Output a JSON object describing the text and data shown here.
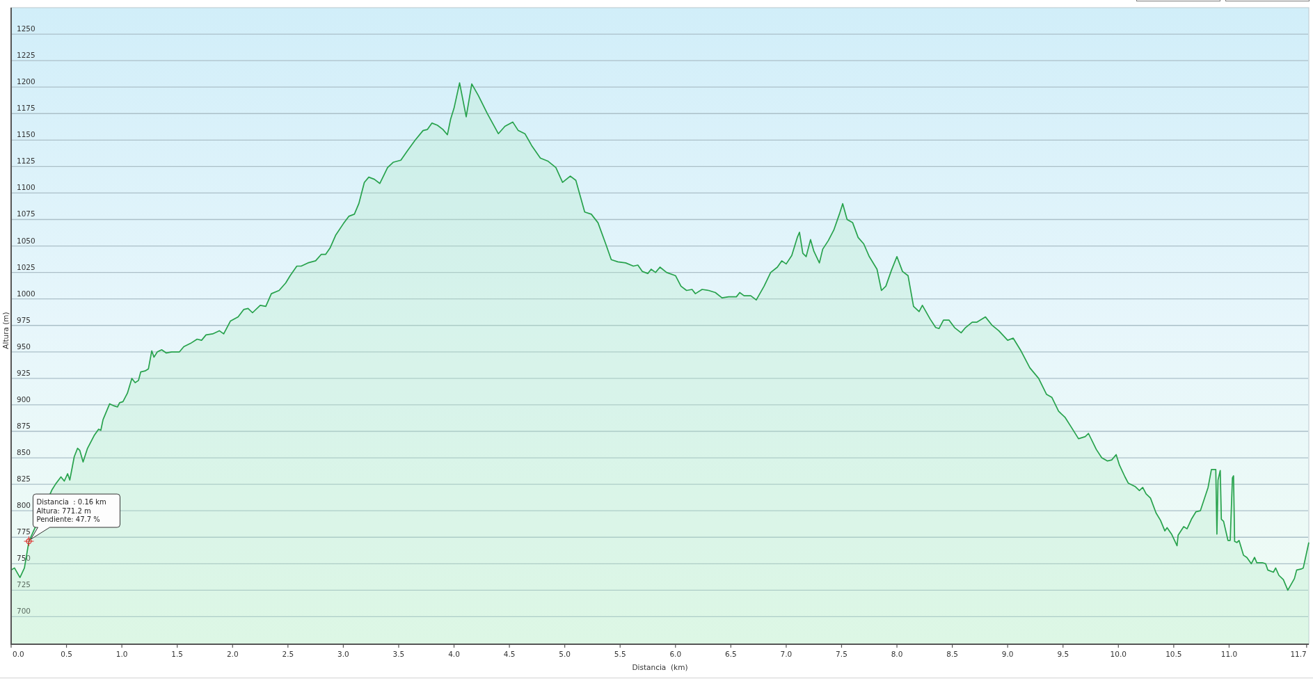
{
  "profile_chart": {
    "chart_data": {
      "type": "area",
      "xlabel": "Distancia  (km)",
      "ylabel": "Altura (m)",
      "grid": true,
      "x": [
        0,
        0.03,
        0.08,
        0.12,
        0.16,
        0.37,
        0.4,
        0.45,
        0.48,
        0.51,
        0.53,
        0.57,
        0.6,
        0.62,
        0.65,
        0.69,
        0.75,
        0.79,
        0.81,
        0.83,
        0.89,
        0.93,
        0.96,
        0.98,
        1.01,
        1.05,
        1.09,
        1.12,
        1.15,
        1.17,
        1.21,
        1.24,
        1.27,
        1.29,
        1.32,
        1.36,
        1.4,
        1.45,
        1.52,
        1.56,
        1.62,
        1.68,
        1.72,
        1.76,
        1.82,
        1.88,
        1.92,
        1.98,
        2.05,
        2.1,
        2.14,
        2.18,
        2.25,
        2.3,
        2.35,
        2.42,
        2.48,
        2.52,
        2.58,
        2.62,
        2.68,
        2.75,
        2.8,
        2.84,
        2.88,
        2.93,
        3,
        3.05,
        3.1,
        3.14,
        3.19,
        3.23,
        3.28,
        3.33,
        3.4,
        3.45,
        3.52,
        3.58,
        3.65,
        3.72,
        3.76,
        3.8,
        3.85,
        3.9,
        3.94,
        3.97,
        4,
        4.05,
        4.11,
        4.16,
        4.22,
        4.3,
        4.4,
        4.46,
        4.53,
        4.58,
        4.64,
        4.7,
        4.78,
        4.85,
        4.92,
        4.98,
        5.05,
        5.1,
        5.18,
        5.24,
        5.3,
        5.37,
        5.42,
        5.48,
        5.55,
        5.62,
        5.66,
        5.7,
        5.75,
        5.78,
        5.82,
        5.86,
        5.92,
        6,
        6.05,
        6.1,
        6.15,
        6.18,
        6.24,
        6.3,
        6.36,
        6.42,
        6.48,
        6.55,
        6.58,
        6.62,
        6.68,
        6.73,
        6.8,
        6.86,
        6.92,
        6.96,
        7,
        7.05,
        7.1,
        7.12,
        7.15,
        7.18,
        7.22,
        7.25,
        7.3,
        7.33,
        7.38,
        7.43,
        7.48,
        7.51,
        7.55,
        7.6,
        7.65,
        7.7,
        7.75,
        7.82,
        7.86,
        7.9,
        7.95,
        8,
        8.05,
        8.1,
        8.15,
        8.2,
        8.23,
        8.3,
        8.35,
        8.38,
        8.42,
        8.47,
        8.52,
        8.58,
        8.62,
        8.68,
        8.72,
        8.8,
        8.86,
        8.92,
        9,
        9.05,
        9.12,
        9.2,
        9.28,
        9.35,
        9.4,
        9.46,
        9.52,
        9.58,
        9.64,
        9.7,
        9.73,
        9.8,
        9.85,
        9.9,
        9.94,
        9.98,
        10.01,
        10.06,
        10.09,
        10.15,
        10.19,
        10.22,
        10.25,
        10.29,
        10.34,
        10.38,
        10.42,
        10.44,
        10.48,
        10.53,
        10.54,
        10.59,
        10.62,
        10.66,
        10.7,
        10.74,
        10.81,
        10.84,
        10.88,
        10.89,
        10.9,
        10.92,
        10.93,
        10.95,
        10.99,
        11.01,
        11.03,
        11.04,
        11.05,
        11.07,
        11.09,
        11.13,
        11.16,
        11.2,
        11.23,
        11.25,
        11.3,
        11.33,
        11.35,
        11.4,
        11.42,
        11.45,
        11.49,
        11.53,
        11.59,
        11.61,
        11.65,
        11.67,
        11.72
      ],
      "values": [
        744,
        746,
        737,
        746,
        771,
        820,
        825,
        832,
        828,
        835,
        829,
        851,
        859,
        857,
        846,
        859,
        871,
        877,
        876,
        886,
        901,
        899,
        898,
        902,
        903,
        911,
        925,
        921,
        923,
        931,
        932,
        934,
        951,
        945,
        950,
        952,
        949,
        950,
        950,
        955,
        958,
        962,
        961,
        966,
        967,
        970,
        967,
        979,
        983,
        990,
        991,
        987,
        994,
        993,
        1005,
        1008,
        1015,
        1022,
        1031,
        1031,
        1034,
        1036,
        1042,
        1042,
        1048,
        1060,
        1071,
        1078,
        1080,
        1090,
        1110,
        1115,
        1113,
        1109,
        1124,
        1129,
        1131,
        1140,
        1150,
        1159,
        1160,
        1166,
        1164,
        1160,
        1155,
        1170,
        1180,
        1204,
        1172,
        1203,
        1192,
        1175,
        1156,
        1163,
        1167,
        1159,
        1156,
        1145,
        1133,
        1130,
        1124,
        1110,
        1116,
        1112,
        1082,
        1080,
        1072,
        1052,
        1037,
        1035,
        1034,
        1031,
        1032,
        1026,
        1024,
        1028,
        1025,
        1030,
        1025,
        1022,
        1012,
        1008,
        1009,
        1005,
        1009,
        1008,
        1006,
        1001,
        1002,
        1002,
        1006,
        1003,
        1003,
        999,
        1012,
        1025,
        1030,
        1036,
        1033,
        1041,
        1058,
        1063,
        1043,
        1040,
        1056,
        1045,
        1034,
        1047,
        1055,
        1065,
        1080,
        1090,
        1075,
        1072,
        1058,
        1052,
        1040,
        1028,
        1008,
        1012,
        1027,
        1040,
        1026,
        1022,
        993,
        988,
        994,
        981,
        973,
        972,
        980,
        980,
        973,
        968,
        973,
        978,
        978,
        983,
        975,
        970,
        961,
        963,
        951,
        935,
        925,
        910,
        907,
        894,
        888,
        878,
        868,
        870,
        873,
        858,
        850,
        847,
        848,
        853,
        843,
        832,
        826,
        823,
        819,
        822,
        816,
        812,
        798,
        791,
        781,
        784,
        778,
        767,
        777,
        785,
        783,
        792,
        799,
        800,
        822,
        839,
        839,
        778,
        829,
        838,
        792,
        790,
        772,
        772,
        831,
        833,
        771,
        770,
        772,
        758,
        756,
        750,
        756,
        751,
        751,
        750,
        744,
        742,
        746,
        739,
        735,
        725,
        736,
        744,
        745,
        746,
        770
      ],
      "xlim": [
        0,
        11.72
      ],
      "ylim": [
        674,
        1275
      ],
      "xticks": [
        {
          "value": 0,
          "label": "0.0"
        },
        {
          "value": 0.5,
          "label": "0.5"
        },
        {
          "value": 1,
          "label": "1.0"
        },
        {
          "value": 1.5,
          "label": "1.5"
        },
        {
          "value": 2,
          "label": "2.0"
        },
        {
          "value": 2.5,
          "label": "2.5"
        },
        {
          "value": 3,
          "label": "3.0"
        },
        {
          "value": 3.5,
          "label": "3.5"
        },
        {
          "value": 4,
          "label": "4.0"
        },
        {
          "value": 4.5,
          "label": "4.5"
        },
        {
          "value": 5,
          "label": "5.0"
        },
        {
          "value": 5.5,
          "label": "5.5"
        },
        {
          "value": 6,
          "label": "6.0"
        },
        {
          "value": 6.5,
          "label": "6.5"
        },
        {
          "value": 7,
          "label": "7.0"
        },
        {
          "value": 7.5,
          "label": "7.5"
        },
        {
          "value": 8,
          "label": "8.0"
        },
        {
          "value": 8.5,
          "label": "8.5"
        },
        {
          "value": 9,
          "label": "9.0"
        },
        {
          "value": 9.5,
          "label": "9.5"
        },
        {
          "value": 10,
          "label": "10.0"
        },
        {
          "value": 10.5,
          "label": "10.5"
        },
        {
          "value": 11,
          "label": "11.0"
        },
        {
          "value": 11.7,
          "label": "11.7"
        }
      ],
      "yticks": [
        700,
        725,
        750,
        775,
        800,
        825,
        850,
        875,
        900,
        925,
        950,
        975,
        1000,
        1025,
        1050,
        1075,
        1100,
        1125,
        1150,
        1175,
        1200,
        1225,
        1250
      ],
      "annotations": [
        {
          "x": 0.16,
          "y": 771.2,
          "text": "Distancia  : 0.16 km\nAltura: 771.2 m\nPendiente: 47.7 %"
        }
      ]
    }
  }
}
